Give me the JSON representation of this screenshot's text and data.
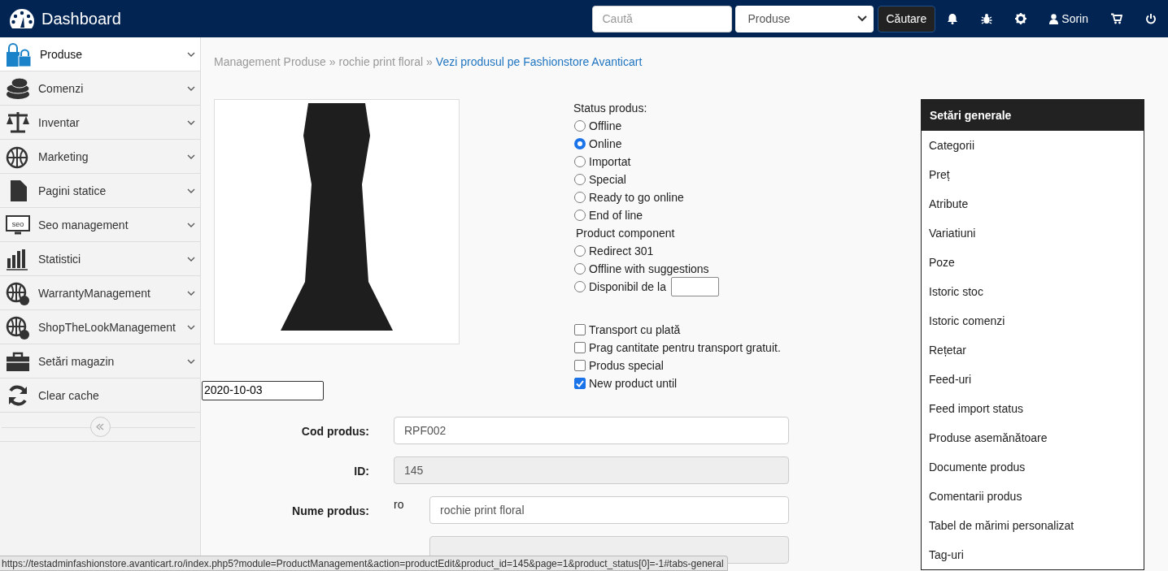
{
  "header": {
    "title": "Dashboard",
    "search": {
      "placeholder": "Caută"
    },
    "scope_select": {
      "value": "Produse"
    },
    "search_button": "Căutare",
    "user": "Sorin"
  },
  "sidebar": {
    "items": [
      {
        "label": "Produse",
        "expandable": true,
        "selected": true
      },
      {
        "label": "Comenzi",
        "expandable": true,
        "selected": false
      },
      {
        "label": "Inventar",
        "expandable": true,
        "selected": false
      },
      {
        "label": "Marketing",
        "expandable": true,
        "selected": false
      },
      {
        "label": "Pagini statice",
        "expandable": true,
        "selected": false
      },
      {
        "label": "Seo management",
        "expandable": true,
        "selected": false,
        "icon_text": "seo"
      },
      {
        "label": "Statistici",
        "expandable": true,
        "selected": false
      },
      {
        "label": "WarrantyManagement",
        "expandable": true,
        "selected": false
      },
      {
        "label": "ShopTheLookManagement",
        "expandable": true,
        "selected": false
      },
      {
        "label": "Setări magazin",
        "expandable": true,
        "selected": false
      },
      {
        "label": "Clear cache",
        "expandable": false,
        "selected": false
      }
    ]
  },
  "breadcrumb": [
    {
      "text": "Management Produse",
      "kind": "crumb"
    },
    {
      "text": "»",
      "kind": "sep"
    },
    {
      "text": "rochie print floral",
      "kind": "crumb"
    },
    {
      "text": "»",
      "kind": "sep"
    },
    {
      "text": "Vezi produsul pe Fashionstore Avanticart",
      "kind": "link"
    }
  ],
  "status": {
    "title": "Status produs:",
    "options": [
      {
        "label": "Offline",
        "selected": false
      },
      {
        "label": "Online",
        "selected": true
      },
      {
        "label": "Importat",
        "selected": false
      },
      {
        "label": "Special",
        "selected": false
      },
      {
        "label": "Ready to go online",
        "selected": false
      },
      {
        "label": "End of line",
        "selected": false
      }
    ],
    "component_title": "Product component",
    "component_options": [
      {
        "label": "Redirect 301",
        "selected": false,
        "kind": "plain"
      },
      {
        "label": "Offline with suggestions",
        "selected": false,
        "kind": "plain"
      },
      {
        "label": "Disponibil de la",
        "selected": false,
        "kind": "date"
      }
    ]
  },
  "flags": [
    {
      "label": "Transport cu plată",
      "checked": false
    },
    {
      "label": "Prag cantitate pentru transport gratuit.",
      "checked": false
    },
    {
      "label": "Produs special",
      "checked": false
    },
    {
      "label": "New product until",
      "checked": true
    }
  ],
  "new_until": {
    "value": "2020-10-03"
  },
  "form": [
    {
      "label": "Cod produs:",
      "value": "RPF002",
      "disabled": false
    },
    {
      "label": "ID:",
      "value": "145",
      "disabled": true
    },
    {
      "label": "Nume produs:",
      "lang": "ro",
      "value": "rochie print floral",
      "disabled": false
    }
  ],
  "settings_menu": [
    {
      "label": "Setări generale",
      "selected": true
    },
    {
      "label": "Categorii",
      "selected": false
    },
    {
      "label": "Preț",
      "selected": false
    },
    {
      "label": "Atribute",
      "selected": false
    },
    {
      "label": "Variatiuni",
      "selected": false
    },
    {
      "label": "Poze",
      "selected": false
    },
    {
      "label": "Istoric stoc",
      "selected": false
    },
    {
      "label": "Istoric comenzi",
      "selected": false
    },
    {
      "label": "Rețetar",
      "selected": false
    },
    {
      "label": "Feed-uri",
      "selected": false
    },
    {
      "label": "Feed import status",
      "selected": false
    },
    {
      "label": "Produse asemănătoare",
      "selected": false
    },
    {
      "label": "Documente produs",
      "selected": false
    },
    {
      "label": "Comentarii produs",
      "selected": false
    },
    {
      "label": "Tabel de mărimi personalizat",
      "selected": false
    },
    {
      "label": "Tag-uri",
      "selected": false
    }
  ],
  "status_bar": {
    "url": "https://testadminfashionstore.avanticart.ro/index.php5?module=ProductManagement&action=productEdit&product_id=145&page=1&product_status[0]=-1#tabs-general"
  }
}
